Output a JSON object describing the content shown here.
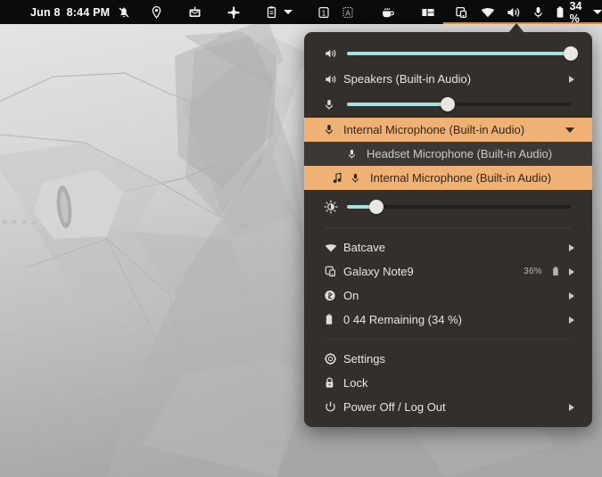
{
  "topbar": {
    "date": "Jun 8",
    "time": "8:44 PM",
    "battery_percent": "34 %",
    "icons": [
      {
        "name": "notifications-muted-icon",
        "glyph": "bell-slash"
      },
      {
        "name": "location-icon",
        "glyph": "pin"
      },
      {
        "name": "mailbox-icon",
        "glyph": "mailbox"
      },
      {
        "name": "slack-icon",
        "glyph": "slack"
      },
      {
        "name": "clipboard-icon",
        "glyph": "clipboard"
      },
      {
        "name": "workspace-1-icon",
        "glyph": "box-1"
      },
      {
        "name": "keyboard-layout-icon",
        "glyph": "box-a"
      },
      {
        "name": "coffee-icon",
        "glyph": "coffee"
      },
      {
        "name": "layout-icon",
        "glyph": "panels"
      },
      {
        "name": "screencast-icon",
        "glyph": "screencast"
      },
      {
        "name": "wifi-icon",
        "glyph": "wifi"
      },
      {
        "name": "volume-icon",
        "glyph": "speaker"
      },
      {
        "name": "microphone-icon",
        "glyph": "mic"
      },
      {
        "name": "battery-icon",
        "glyph": "battery"
      }
    ]
  },
  "menu": {
    "volume_slider": {
      "icon": "speaker-icon",
      "value_percent": 100
    },
    "output_device": {
      "icon": "speaker-icon",
      "label": "Speakers (Built-in Audio)",
      "chevron": "submenu-arrow"
    },
    "mic_slider": {
      "icon": "microphone-icon",
      "value_percent": 45
    },
    "input_device": {
      "icon": "microphone-icon",
      "label": "Internal Microphone (Built-in Audio)",
      "chevron": "expanded-arrow",
      "expanded": true
    },
    "input_device_options": [
      {
        "icon": "microphone-icon",
        "label": "Headset Microphone (Built-in Audio)",
        "selected": false,
        "has_active_note": false
      },
      {
        "icon": "microphone-icon",
        "note_icon": "music-note-icon",
        "label": "Internal Microphone (Built-in Audio)",
        "selected": true,
        "has_active_note": true
      }
    ],
    "brightness_slider": {
      "icon": "brightness-icon",
      "value_percent": 13
    },
    "items": [
      {
        "icon": "wifi-icon",
        "label": "Batcave",
        "aux": "",
        "aux_icon": "",
        "chevron": "submenu-arrow"
      },
      {
        "icon": "phone-link-icon",
        "label": "Galaxy Note9",
        "aux": "36%",
        "aux_icon": "battery-icon",
        "chevron": "submenu-arrow"
      },
      {
        "icon": "bluetooth-icon",
        "label": "On",
        "aux": "",
        "aux_icon": "",
        "chevron": "submenu-arrow"
      },
      {
        "icon": "battery-icon",
        "label": "0 44 Remaining (34 %)",
        "aux": "",
        "aux_icon": "",
        "chevron": "submenu-arrow"
      }
    ],
    "footer_items": [
      {
        "icon": "gear-icon",
        "label": "Settings",
        "chevron": ""
      },
      {
        "icon": "lock-icon",
        "label": "Lock",
        "chevron": ""
      },
      {
        "icon": "power-icon",
        "label": "Power Off / Log Out",
        "chevron": "submenu-arrow"
      }
    ]
  },
  "colors": {
    "accent_orange": "#f0b274",
    "topbar_underline": "#e8922e",
    "menu_bg": "#332f2d",
    "submenu_bg": "#3c3835",
    "slider_fill": "#a6e3e0",
    "topbar_bg": "#0b0b0b"
  }
}
